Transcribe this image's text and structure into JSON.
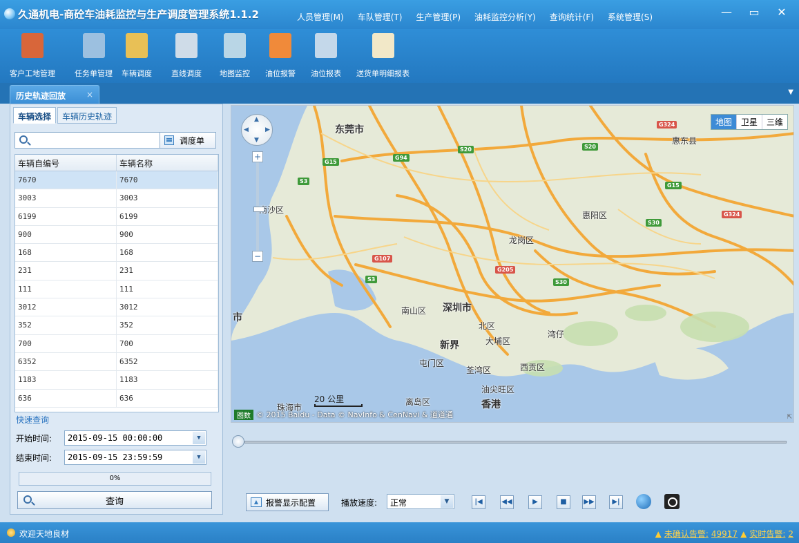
{
  "app": {
    "title": "久通机电-商砼车油耗监控与生产调度管理系统1.1.2"
  },
  "main_menu": [
    "人员管理(M)",
    "车队管理(T)",
    "生产管理(P)",
    "油耗监控分析(Y)",
    "查询统计(F)",
    "系统管理(S)"
  ],
  "window_controls": {
    "minimize": "—",
    "maximize": "▭",
    "close": "✕"
  },
  "toolbar": [
    {
      "label": "客户工地管理",
      "icon": "customer-site-icon",
      "color": "#d8663a"
    },
    {
      "label": "任务单管理",
      "icon": "task-order-icon",
      "color": "#9cc0e0"
    },
    {
      "label": "车辆调度",
      "icon": "vehicle-dispatch-icon",
      "color": "#e8c056"
    },
    {
      "label": "直线调度",
      "icon": "linear-dispatch-icon",
      "color": "#cfdce8"
    },
    {
      "label": "地图监控",
      "icon": "map-monitor-icon",
      "color": "#b9d6e6"
    },
    {
      "label": "油位报警",
      "icon": "oil-alarm-icon",
      "color": "#f08a3a"
    },
    {
      "label": "油位报表",
      "icon": "oil-report-icon",
      "color": "#c4d8ea"
    },
    {
      "label": "送货单明细报表",
      "icon": "delivery-report-icon",
      "color": "#f2e8c8"
    }
  ],
  "tab": {
    "label": "历史轨迹回放",
    "close": "×",
    "dropdown": "▼"
  },
  "left": {
    "subtabs": [
      "车辆选择",
      "车辆历史轨迹"
    ],
    "search_placeholder": "",
    "dispatch_btn": "调度单",
    "columns": [
      "车辆自编号",
      "车辆名称"
    ],
    "rows": [
      [
        "7670",
        "7670"
      ],
      [
        "3003",
        "3003"
      ],
      [
        "6199",
        "6199"
      ],
      [
        "900",
        "900"
      ],
      [
        "168",
        "168"
      ],
      [
        "231",
        "231"
      ],
      [
        "111",
        "111"
      ],
      [
        "3012",
        "3012"
      ],
      [
        "352",
        "352"
      ],
      [
        "700",
        "700"
      ],
      [
        "6352",
        "6352"
      ],
      [
        "1183",
        "1183"
      ],
      [
        "636",
        "636"
      ]
    ],
    "quick_query": "快速查询",
    "start_label": "开始时间:",
    "start_value": "2015-09-15 00:00:00",
    "end_label": "结束时间:",
    "end_value": "2015-09-15 23:59:59",
    "progress": "0%",
    "query_btn": "查询"
  },
  "map": {
    "types": [
      "地图",
      "卫星",
      "三维"
    ],
    "labels": [
      "东莞市",
      "惠东县",
      "南沙区",
      "惠阳区",
      "龙岗区",
      "南山区",
      "深圳市",
      "北区",
      "大埔区",
      "新界",
      "湾仔",
      "屯门区",
      "荃湾区",
      "西贡区",
      "油尖旺区",
      "离岛区",
      "香港",
      "市"
    ],
    "shields": [
      "G15",
      "G94",
      "S20",
      "S20",
      "G324",
      "G15",
      "S30",
      "G324",
      "S3",
      "G107",
      "G205",
      "S3",
      "S30"
    ],
    "scale": "20 公里",
    "copyright": "© 2015 Baidu - Data © NavInfo & CenNavi & 道道通",
    "copyright_badge": "图数",
    "city_partial": "珠海市",
    "pan_arrows": [
      "▲",
      "▼",
      "◀",
      "▶"
    ],
    "zoom_in": "+",
    "zoom_out": "−",
    "resize": "⇱"
  },
  "playback": {
    "alarm_cfg": "报警显示配置",
    "speed_label": "播放速度:",
    "speed_value": "正常",
    "buttons": [
      "|◀",
      "◀◀",
      "▶",
      "■",
      "▶▶",
      "▶|"
    ]
  },
  "status": {
    "welcome": "欢迎天地良材",
    "unconfirmed_label": "未确认告警:",
    "unconfirmed_count": "49917",
    "realtime_label": "实时告警:",
    "realtime_count": "2"
  }
}
